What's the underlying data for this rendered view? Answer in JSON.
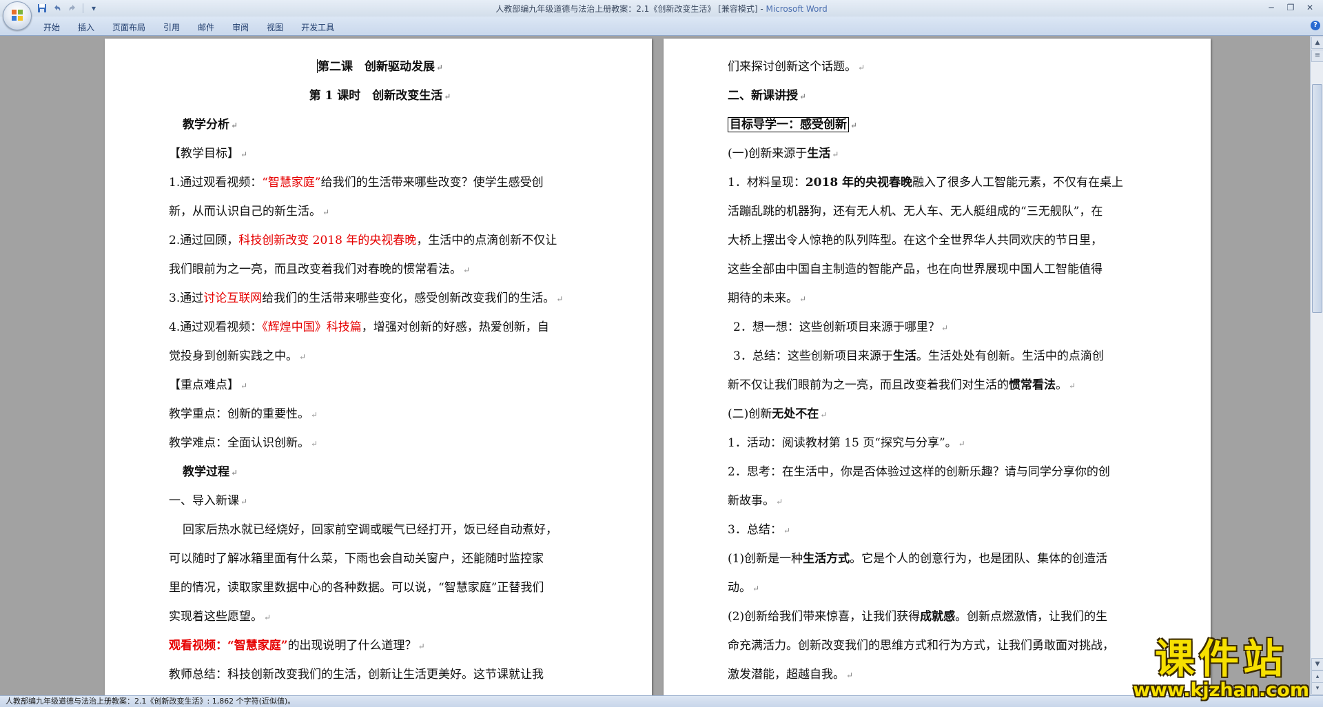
{
  "window": {
    "title": "人教部编九年级道德与法治上册教案：2.1《创新改变生活》 [兼容模式] - ",
    "app_name": "Microsoft Word"
  },
  "ribbon": {
    "tabs": [
      "开始",
      "插入",
      "页面布局",
      "引用",
      "邮件",
      "审阅",
      "视图",
      "开发工具"
    ]
  },
  "icons": {
    "office_button": "office-logo-icon",
    "save": "save-icon",
    "undo": "undo-icon",
    "redo": "redo-icon",
    "customize": "dropdown-icon",
    "help": "help-icon"
  },
  "left_page": {
    "lesson_title": "第二课　创新驱动发展",
    "lesson_subtitle": "第 1 课时　创新改变生活",
    "analysis_heading": "教学分析",
    "goals_heading": "【教学目标】",
    "goal1_a": "1.通过观看视频：",
    "goal1_red": "“智慧家庭”",
    "goal1_b": "给我们的生活带来哪些改变？使学生感受创",
    "goal1_c": "新，从而认识自己的新生活。",
    "goal2_a": "2.通过回顾，",
    "goal2_red": "科技创新改变 2018 年的央视春晚",
    "goal2_b": "，生活中的点滴创新不仅让",
    "goal2_c": "我们眼前为之一亮，而且改变着我们对春晚的惯常看法。",
    "goal3_a": "3.通过",
    "goal3_red": "讨论互联网",
    "goal3_b": "给我们的生活带来哪些变化，感受创新改变我们的生活。",
    "goal4_a": "4.通过观看视频：",
    "goal4_red": "《辉煌中国》科技篇",
    "goal4_b": "，增强对创新的好感，热爱创新，自",
    "goal4_c": "觉投身到创新实践之中。",
    "key_heading": "【重点难点】",
    "key_point": "教学重点：创新的重要性。",
    "difficulty": "教学难点：全面认识创新。",
    "process_heading": "教学过程",
    "intro": "一、导入新课",
    "para1": "回家后热水就已经烧好，回家前空调或暖气已经打开，饭已经自动煮好，",
    "para2": "可以随时了解冰箱里面有什么菜，下雨也会自动关窗户，还能随时监控家",
    "para3": "里的情况，读取家里数据中心的各种数据。可以说，“智慧家庭”正替我们",
    "para4": "实现着这些愿望。",
    "watch_red": "观看视频：“智慧家庭”",
    "watch_q": "的出现说明了什么道理？",
    "teacher_sum": "教师总结：科技创新改变我们的生活，创新让生活更美好。这节课就让我"
  },
  "right_page": {
    "cont": "们来探讨创新这个话题。",
    "section2": "二、新课讲授",
    "target1": "目标导学一：感受创新",
    "sub1_a": "(一)创新来源于",
    "sub1_b": "生活",
    "m1_a": "1．材料呈现：",
    "m1_b": "2018 年的央视春晚",
    "m1_c": "融入了很多人工智能元素，不仅有在桌上",
    "m1_d": "活蹦乱跳的机器狗，还有无人机、无人车、无人艇组成的“三无舰队”，在",
    "m1_e": "大桥上摆出令人惊艳的队列阵型。在这个全世界华人共同欢庆的节日里，",
    "m1_f": "这些全部由中国自主制造的智能产品，也在向世界展现中国人工智能值得",
    "m1_g": "期待的未来。",
    "m2": "2．想一想：这些创新项目来源于哪里？",
    "m3_a": "3．总结：这些创新项目来源于",
    "m3_b": "生活",
    "m3_c": "。生活处处有创新。生活中的点滴创",
    "m3_d": "新不仅让我们眼前为之一亮，而且改变着我们对生活的",
    "m3_e": "惯常看法",
    "m3_f": "。",
    "sub2_a": "(二)创新",
    "sub2_b": "无处不在",
    "a1": "1．活动：阅读教材第 15 页“探究与分享”。",
    "a2_a": "2．思考：在生活中，你是否体验过这样的创新乐趣？请与同学分享你的创",
    "a2_b": "新故事。",
    "a3": "3．总结：",
    "s1_a": "(1)创新是一种",
    "s1_b": "生活方式",
    "s1_c": "。它是个人的创意行为，也是团队、集体的创造活",
    "s1_d": "动。",
    "s2_a": "(2)创新给我们带来惊喜，让我们获得",
    "s2_b": "成就感",
    "s2_c": "。创新点燃激情，让我们的生",
    "s2_d": "命充满活力。创新改变我们的思维方式和行为方式，让我们勇敢面对挑战，",
    "s2_e": "激发潜能，超越自我。"
  },
  "status_bar": {
    "text": "人教部编九年级道德与法治上册教案：2.1《创新改变生活》: 1,862 个字符(近似值)。"
  },
  "watermark": {
    "main": "课件站",
    "sub": "www.kjzhan.com"
  },
  "colors": {
    "accent_red": "#e60000",
    "watermark_yellow": "#f7e000"
  }
}
